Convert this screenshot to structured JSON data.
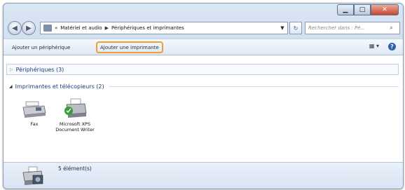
{
  "window": {
    "controls": {
      "minimize": "▁",
      "maximize": "□",
      "close": "✕"
    }
  },
  "nav": {
    "back_icon": "arrow-left-icon",
    "forward_icon": "arrow-right-icon",
    "breadcrumb_overflow": "«",
    "breadcrumb": [
      "Matériel et audio",
      "Périphériques et imprimantes"
    ],
    "search_placeholder": "Rechercher dans : Pé..."
  },
  "toolbar": {
    "add_device": "Ajouter un périphérique",
    "add_printer": "Ajouter une imprimante",
    "highlight_color": "#f0a030"
  },
  "groups": {
    "devices": "Périphériques (3)",
    "printers": "Imprimantes et télécopieurs (2)"
  },
  "items": [
    {
      "label": "Fax",
      "icon": "fax-icon"
    },
    {
      "label": "Microsoft XPS Document Writer",
      "icon": "xps-printer-icon"
    }
  ],
  "details": {
    "count": "5 élément(s)"
  }
}
